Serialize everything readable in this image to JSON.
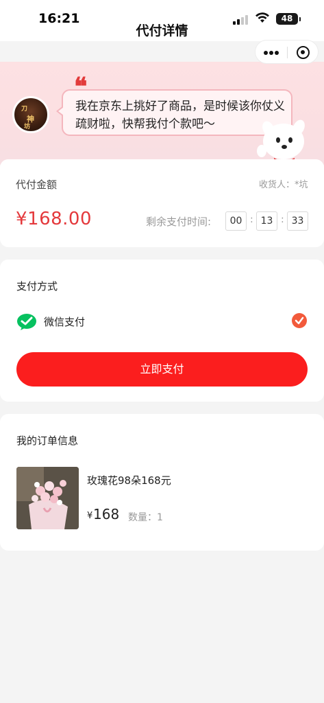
{
  "status_bar": {
    "time": "16:21",
    "battery": "48"
  },
  "nav": {
    "title": "代付详情"
  },
  "banner": {
    "quote_mark": "❝",
    "avatar_chars": [
      "刀",
      "神",
      "坊"
    ],
    "message": "我在京东上挑好了商品，是时候该你仗义疏财啦，快帮我付个款吧～"
  },
  "payment_card": {
    "label": "代付金额",
    "receiver_label": "收货人：",
    "receiver_name": "*坑",
    "amount": "¥168.00",
    "countdown_label": "剩余支付时间:",
    "countdown": {
      "hours": "00",
      "minutes": "13",
      "seconds": "33"
    },
    "colon": ":"
  },
  "method_card": {
    "title": "支付方式",
    "method_label": "微信支付",
    "pay_button": "立即支付"
  },
  "order_card": {
    "title": "我的订单信息",
    "product_name": "玫瑰花98朵168元",
    "price_symbol": "¥",
    "price": "168",
    "quantity_label": "数量：",
    "quantity": "1"
  },
  "colors": {
    "accent_red": "#e4393c",
    "button_red": "#fb1e1e",
    "wechat_green": "#07c160",
    "check_orange": "#f25a3b"
  }
}
